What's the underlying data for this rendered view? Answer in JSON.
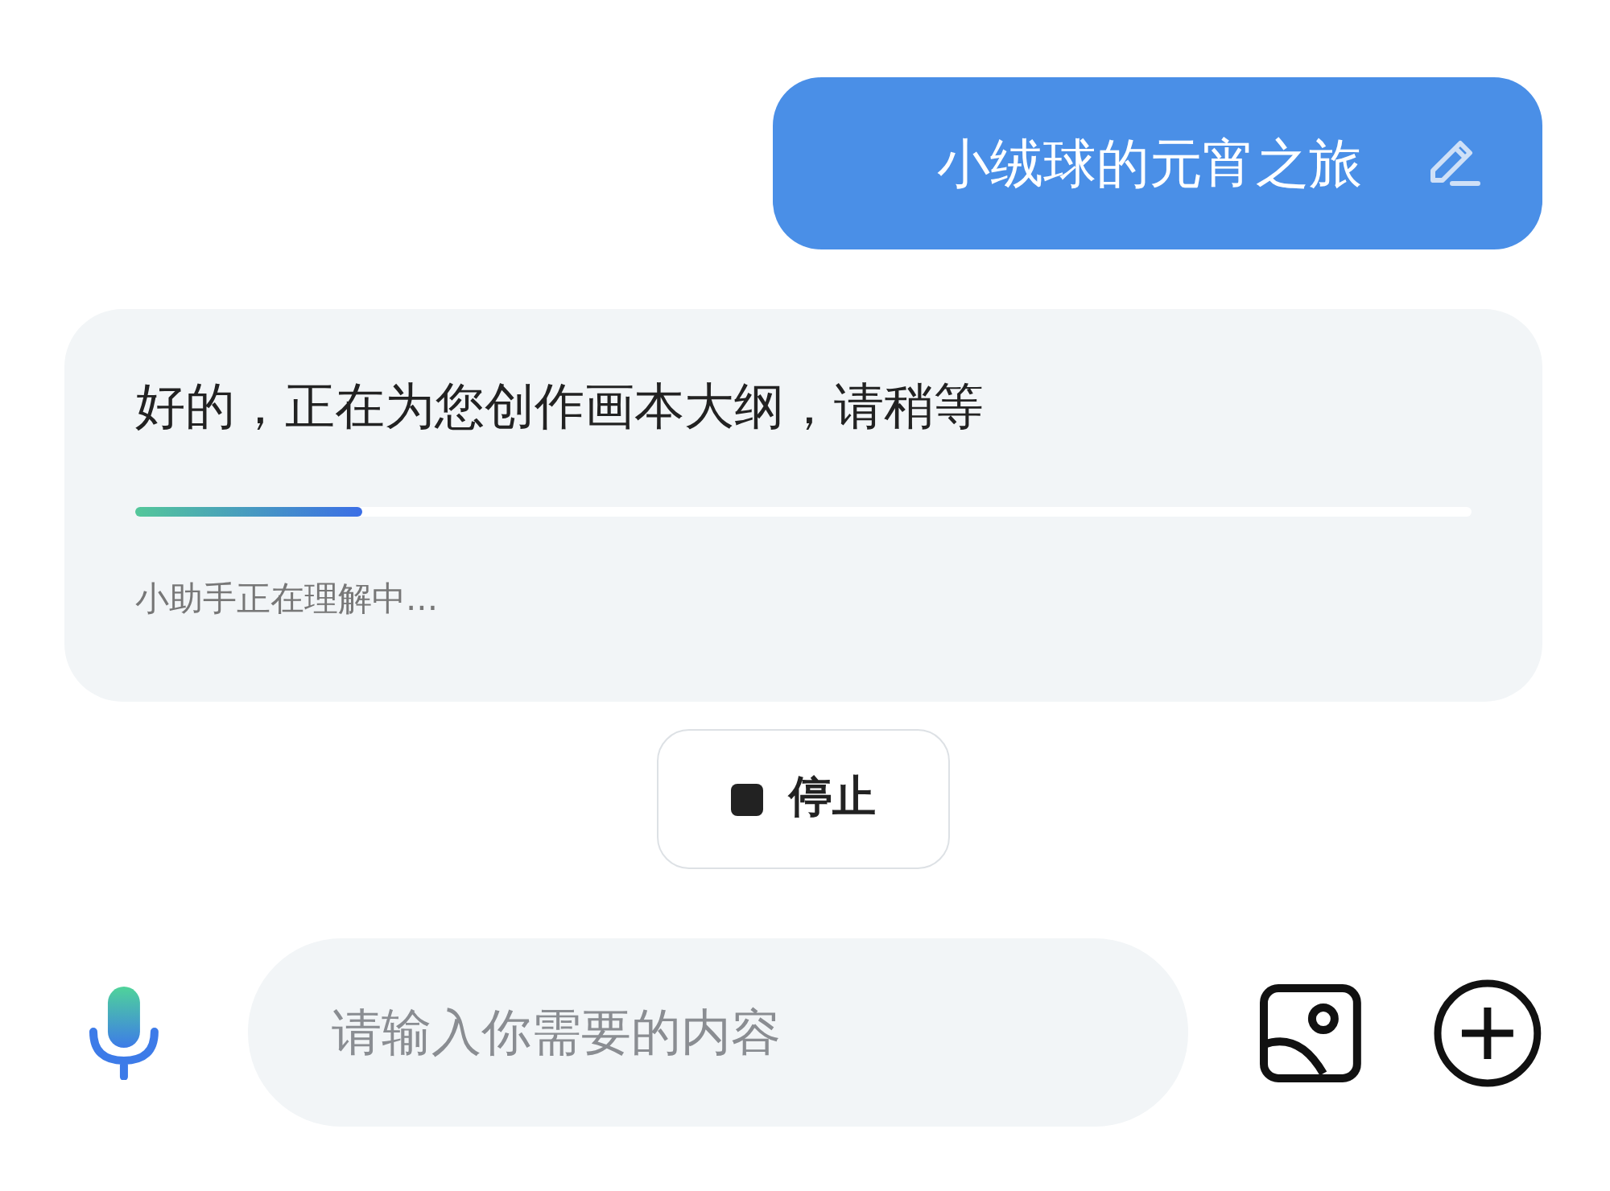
{
  "user_message": {
    "text": "小绒球的元宵之旅"
  },
  "assistant_card": {
    "text": "好的，正在为您创作画本大纲，请稍等",
    "progress": {
      "level": 0.17
    },
    "status": "小助手正在理解中..."
  },
  "stop_button": {
    "label": "停止"
  },
  "input": {
    "placeholder": "请输入你需要的内容"
  }
}
